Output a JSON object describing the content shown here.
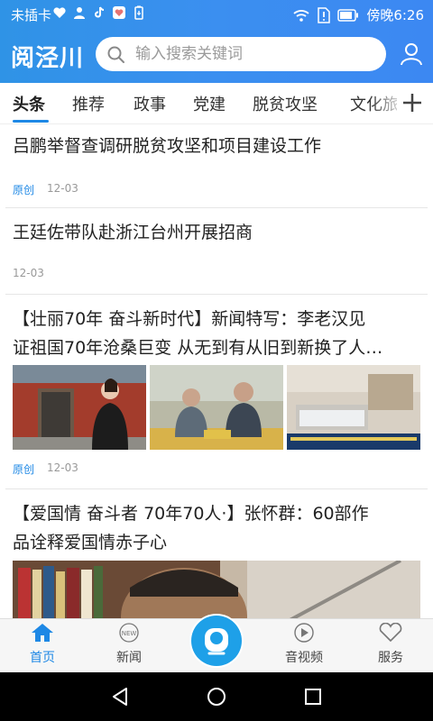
{
  "status_bar": {
    "carrier": "未插卡",
    "time": "傍晚6:26"
  },
  "app": {
    "title": "阅泾川",
    "search_placeholder": "输入搜索关键词"
  },
  "tabs": [
    {
      "label": "头条",
      "active": true
    },
    {
      "label": "推荐",
      "active": false
    },
    {
      "label": "政事",
      "active": false
    },
    {
      "label": "党建",
      "active": false
    },
    {
      "label": "脱贫攻坚",
      "active": false
    },
    {
      "label": "文化旅",
      "active": false
    }
  ],
  "articles": [
    {
      "title": "吕鹏举督查调研脱贫攻坚和项目建设工作",
      "source": "原创",
      "date": "12-03"
    },
    {
      "title": "王廷佐带队赴浙江台州开展招商",
      "date": "12-03"
    },
    {
      "title_line1": "【壮丽70年 奋斗新时代】新闻特写：李老汉见",
      "title_line2": "证祖国70年沧桑巨变 从无到有从旧到新换了人…",
      "source": "原创",
      "date": "12-03"
    },
    {
      "title_line1": "【爱国情 奋斗者  70年70人·】张怀群：60部作",
      "title_line2": "品诠释爱国情赤子心"
    }
  ],
  "bottom_nav": [
    {
      "label": "首页",
      "icon": "home-icon",
      "active": true
    },
    {
      "label": "新闻",
      "icon": "news-icon",
      "badge": "NEW",
      "active": false
    },
    {
      "label": "音视频",
      "icon": "play-icon",
      "active": false
    },
    {
      "label": "服务",
      "icon": "heart-icon",
      "active": false
    }
  ],
  "colors": {
    "accent": "#1e88e5",
    "header_start": "#2f93e6",
    "header_end": "#3c88f2",
    "center_button": "#1ea0e8"
  }
}
